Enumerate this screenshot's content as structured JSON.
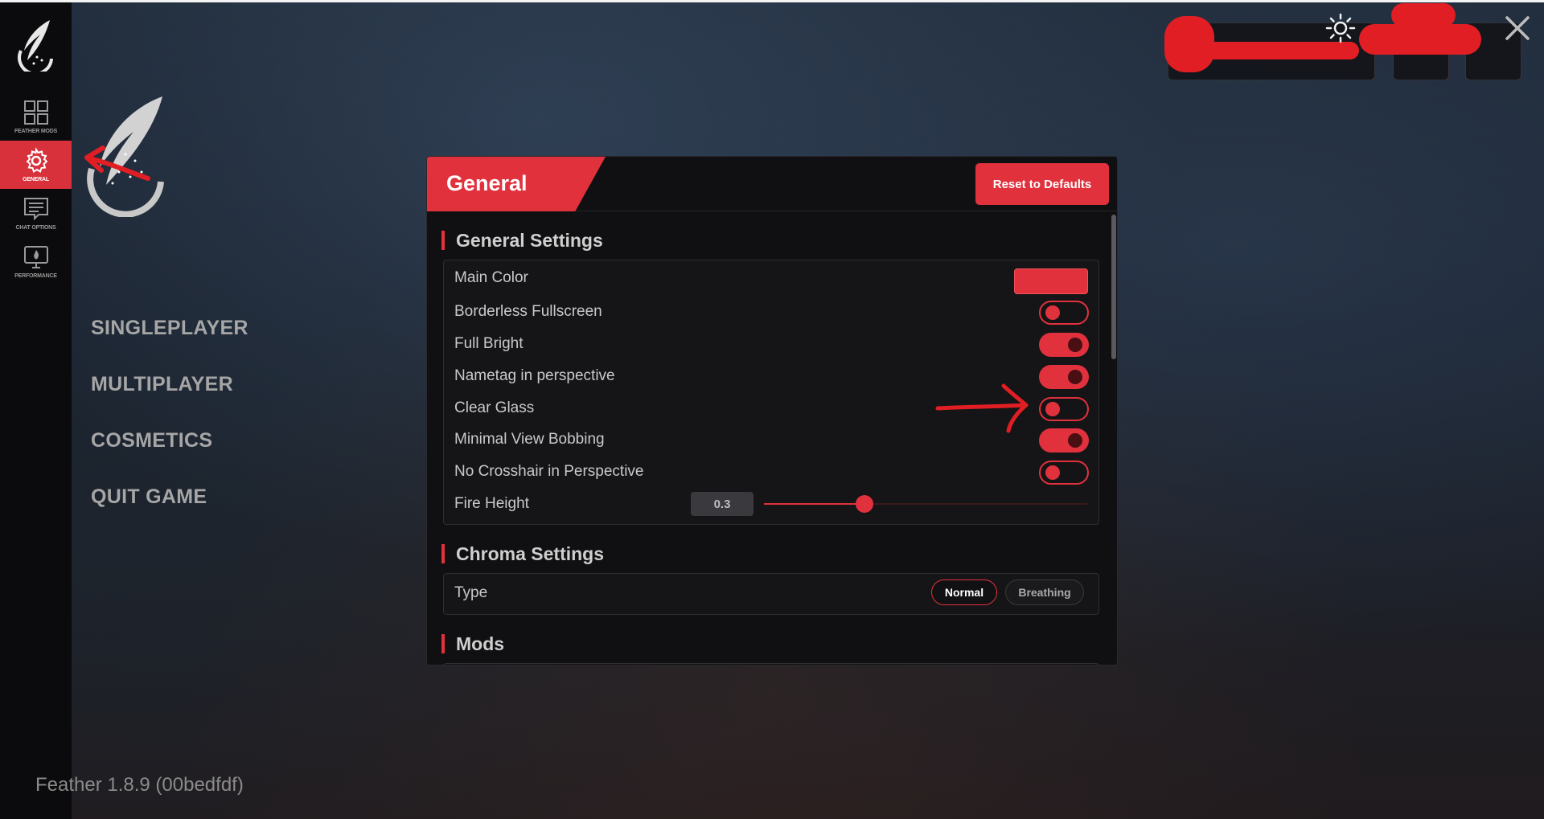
{
  "sidebar": {
    "logo_icon": "feather-logo-icon",
    "items": [
      {
        "label": "FEATHER MODS",
        "icon": "grid-icon",
        "active": false
      },
      {
        "label": "GENERAL",
        "icon": "gear-icon",
        "active": true
      },
      {
        "label": "CHAT OPTIONS",
        "icon": "chat-icon",
        "active": false
      },
      {
        "label": "PERFORMANCE",
        "icon": "monitor-flame-icon",
        "active": false
      }
    ]
  },
  "main_menu": {
    "items": [
      "SINGLEPLAYER",
      "MULTIPLAYER",
      "COSMETICS",
      "QUIT GAME"
    ]
  },
  "version": "Feather 1.8.9 (00bedfdf)",
  "top_right": {
    "theme_icon": "sun-icon",
    "close_icon": "close-icon"
  },
  "panel": {
    "title": "General",
    "reset_label": "Reset to Defaults",
    "sections": {
      "general": {
        "title": "General Settings",
        "main_color_label": "Main Color",
        "main_color": "#e1313d",
        "toggles": [
          {
            "label": "Borderless Fullscreen",
            "on": false
          },
          {
            "label": "Full Bright",
            "on": true
          },
          {
            "label": "Nametag in perspective",
            "on": true
          },
          {
            "label": "Clear Glass",
            "on": false
          },
          {
            "label": "Minimal View Bobbing",
            "on": true
          },
          {
            "label": "No Crosshair in Perspective",
            "on": false
          }
        ],
        "fire_height": {
          "label": "Fire Height",
          "value": "0.3",
          "fraction": 0.31
        }
      },
      "chroma": {
        "title": "Chroma Settings",
        "type_label": "Type",
        "options": [
          "Normal",
          "Breathing"
        ],
        "selected": "Normal"
      },
      "mods": {
        "title": "Mods"
      }
    }
  },
  "colors": {
    "accent": "#e1313d",
    "annotation": "#e01e23"
  }
}
